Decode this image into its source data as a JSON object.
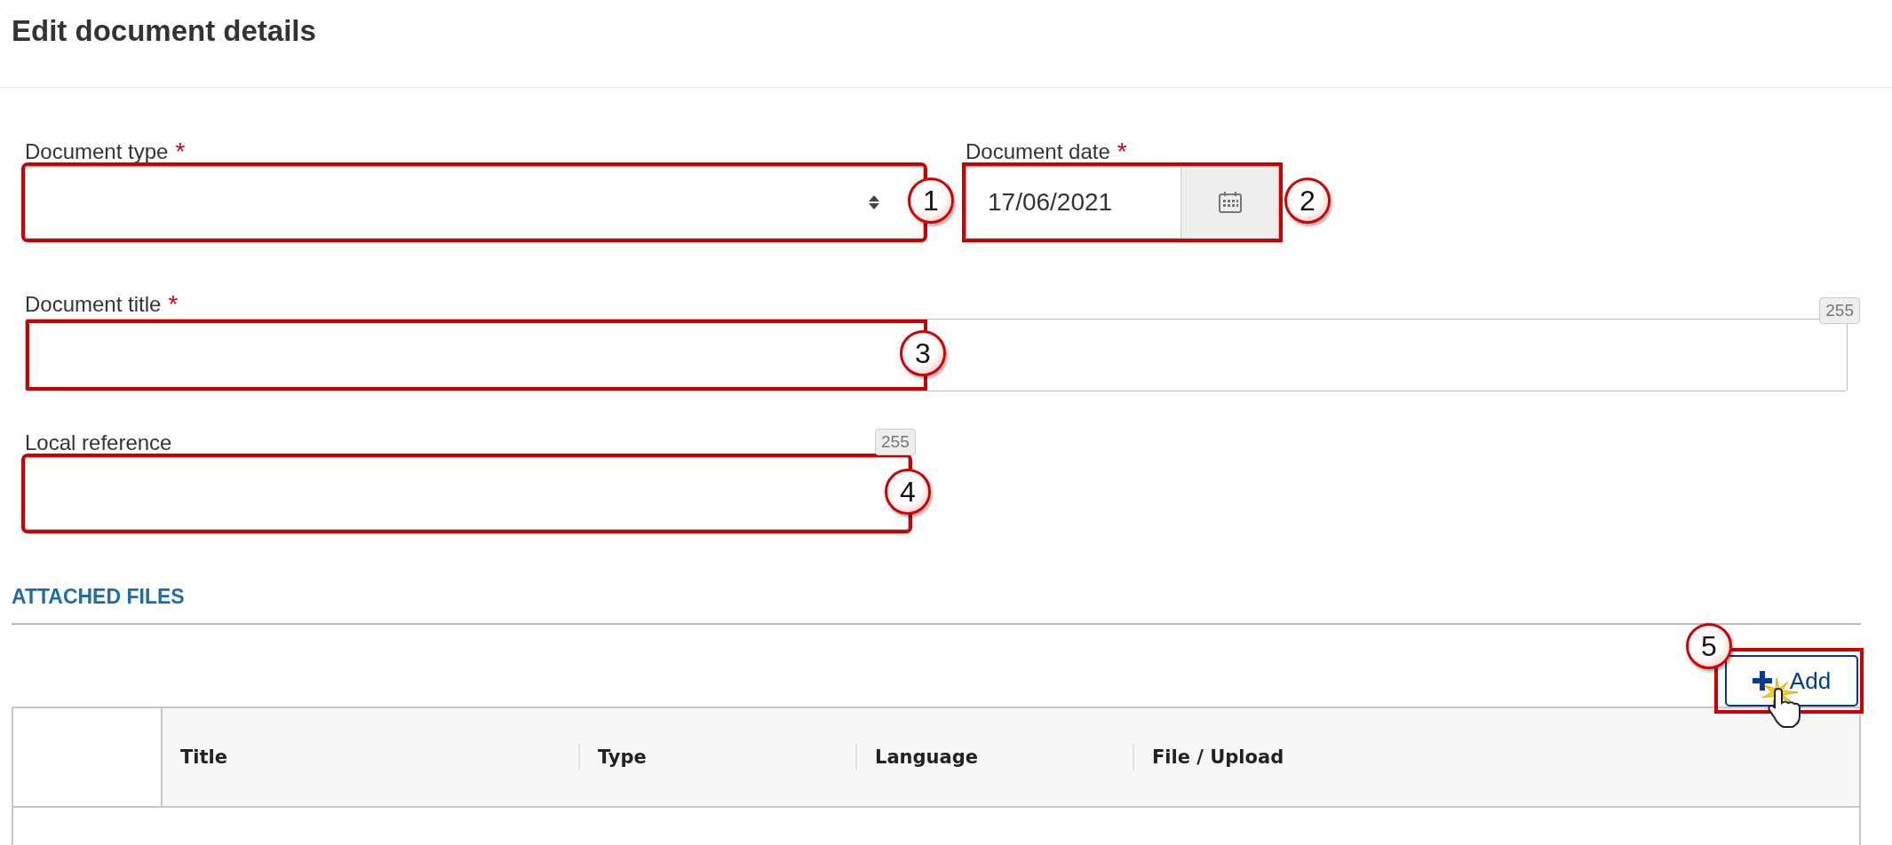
{
  "page": {
    "title": "Edit document details"
  },
  "fields": [
    {
      "kind": "select",
      "label": "Document type",
      "required_mark": "*",
      "callout": "1"
    },
    {
      "kind": "date",
      "label": "Document date",
      "required_mark": "*",
      "value": "17/06/2021",
      "callout": "2"
    },
    {
      "kind": "text",
      "label": "Document title",
      "required_mark": "*",
      "counter": "255",
      "callout": "3"
    },
    {
      "kind": "text",
      "label": "Local reference",
      "counter": "255",
      "callout": "4"
    }
  ],
  "attached_files": {
    "heading": "ATTACHED FILES",
    "add_button": {
      "label": "Add",
      "callout": "5"
    },
    "table": {
      "columns": [
        "Title",
        "Type",
        "Language",
        "File / Upload"
      ]
    }
  }
}
